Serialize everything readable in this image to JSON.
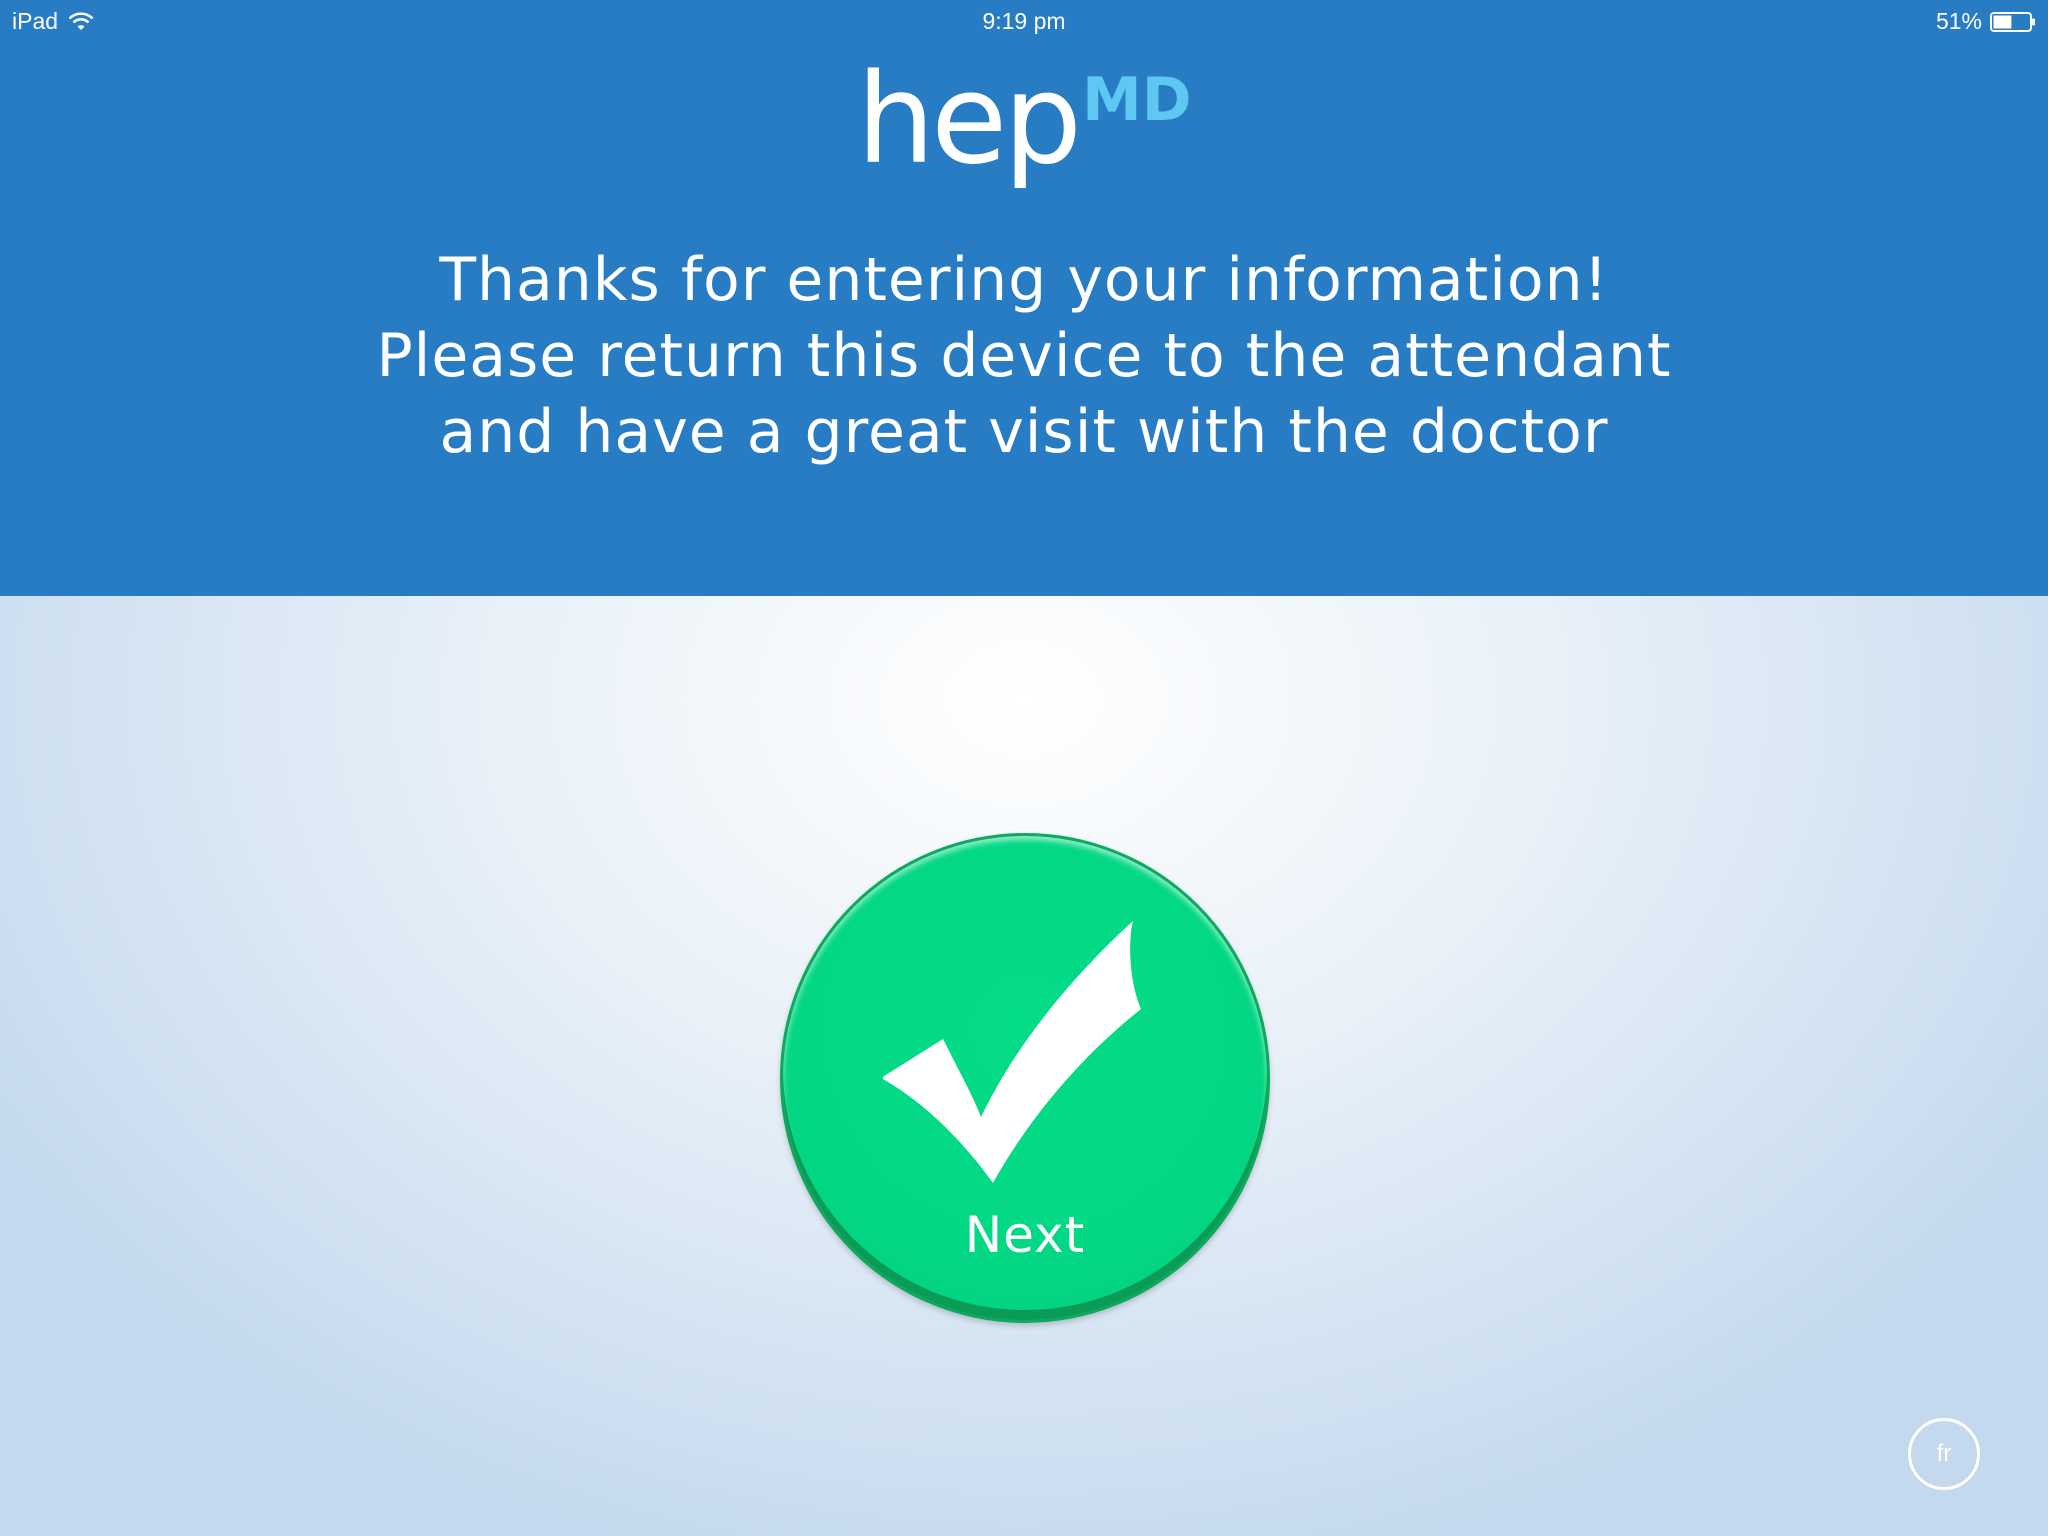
{
  "status_bar": {
    "device": "iPad",
    "time": "9:19 pm",
    "battery_percent": "51%",
    "battery_level": 0.51,
    "wifi_icon": "wifi-icon",
    "battery_icon": "battery-icon"
  },
  "logo": {
    "text": "hep",
    "superscript": "MD"
  },
  "message": {
    "line1": "Thanks for entering your information!",
    "line2": "Please return this device to the attendant",
    "line3": "and have a great visit with the doctor"
  },
  "next_button": {
    "label": "Next",
    "icon": "checkmark-icon"
  },
  "language_button": {
    "label": "fr"
  },
  "colors": {
    "header_blue": "#277cc4",
    "logo_md": "#5ec8f2",
    "button_green": "#03d784"
  }
}
